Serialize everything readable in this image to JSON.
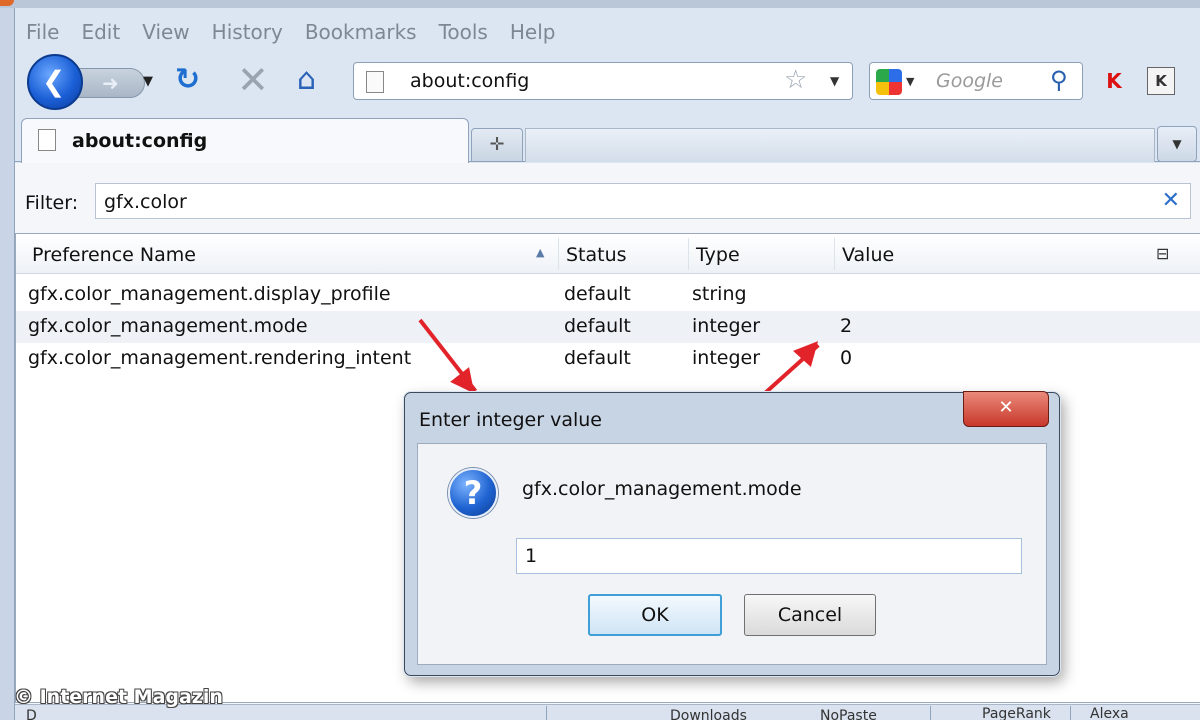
{
  "menu": [
    "File",
    "Edit",
    "View",
    "History",
    "Bookmarks",
    "Tools",
    "Help"
  ],
  "navbar": {
    "url": "about:config",
    "search_placeholder": "Google"
  },
  "tab": {
    "title": "about:config"
  },
  "filter": {
    "label": "Filter:",
    "value": "gfx.color"
  },
  "table": {
    "columns": [
      "Preference Name",
      "Status",
      "Type",
      "Value"
    ],
    "rows": [
      {
        "name": "gfx.color_management.display_profile",
        "status": "default",
        "type": "string",
        "value": ""
      },
      {
        "name": "gfx.color_management.mode",
        "status": "default",
        "type": "integer",
        "value": "2"
      },
      {
        "name": "gfx.color_management.rendering_intent",
        "status": "default",
        "type": "integer",
        "value": "0"
      }
    ]
  },
  "dialog": {
    "title": "Enter integer value",
    "message": "gfx.color_management.mode",
    "input_value": "1",
    "ok_label": "OK",
    "cancel_label": "Cancel"
  },
  "statusbar": {
    "left": "D",
    "item1": "Downloads",
    "item2": "NoPaste",
    "item3": "PageRank",
    "item4": "Alexa"
  },
  "watermark": "© Internet Magazin",
  "colors": {
    "annotation_arrow": "#e3232a",
    "accent_blue": "#1f63d1"
  },
  "icons": [
    "back-icon",
    "forward-icon",
    "reload-icon",
    "stop-icon",
    "home-icon",
    "star-icon",
    "search-icon",
    "question-icon",
    "close-icon",
    "filter-clear-icon",
    "column-picker-icon"
  ]
}
